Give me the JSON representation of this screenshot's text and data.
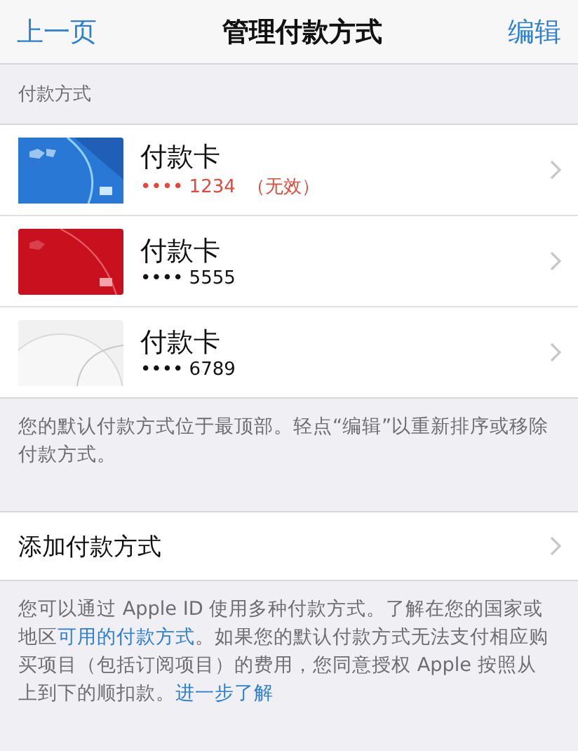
{
  "nav": {
    "back": "上一页",
    "title": "管理付款方式",
    "action": "编辑"
  },
  "section_header": "付款方式",
  "cards": [
    {
      "kind": "blue",
      "title": "付款卡",
      "number": "•••• 1234",
      "status": "（无效）",
      "invalid": true
    },
    {
      "kind": "red",
      "title": "付款卡",
      "number": "•••• 5555",
      "invalid": false
    },
    {
      "kind": "white",
      "title": "付款卡",
      "number": "•••• 6789",
      "invalid": false
    }
  ],
  "cards_footer": "您的默认付款方式位于最顶部。轻点“编辑”以重新排序或移除付款方式。",
  "add_row": "添加付款方式",
  "info_footer": [
    {
      "kind": "text",
      "text": "您可以通过 Apple ID 使用多种付款方式。了解在您的国家或地区"
    },
    {
      "kind": "link",
      "text": "可用的付款方式"
    },
    {
      "kind": "text",
      "text": "。如果您的默认付款方式无法支付相应购买项目（包括订阅项目）的费用，您同意授权 Apple 按照从上到下的顺扣款。"
    },
    {
      "kind": "link",
      "text": "进一步了解"
    }
  ]
}
